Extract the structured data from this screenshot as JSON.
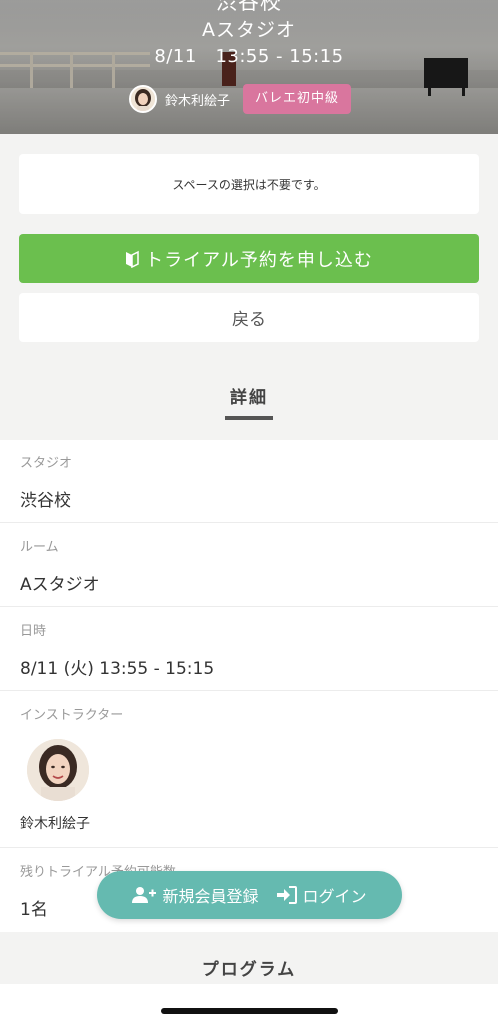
{
  "hero": {
    "school": "渋谷校",
    "room": "Aスタジオ",
    "datetime": "8/11   13:55 - 15:15",
    "instructor": "鈴木利絵子",
    "tag": "バレエ初中級"
  },
  "notice": "スペースの選択は不要です。",
  "actions": {
    "trial_label": "トライアル予約を申し込む",
    "back_label": "戻る"
  },
  "details_section": {
    "title": "詳細",
    "rows": [
      {
        "label": "スタジオ",
        "value": "渋谷校"
      },
      {
        "label": "ルーム",
        "value": "Aスタジオ"
      },
      {
        "label": "日時",
        "value": "8/11 (火) 13:55 - 15:15"
      },
      {
        "label": "インストラクター",
        "value": "鈴木利絵子"
      },
      {
        "label": "残りトライアル予約可能数",
        "value": "1名"
      }
    ]
  },
  "program_section": {
    "title": "プログラム"
  },
  "floating_bar": {
    "register_label": "新規会員登録",
    "login_label": "ログイン"
  },
  "colors": {
    "accent_green": "#6bbf4e",
    "tag_pink": "#d9769e",
    "pill_teal": "#65bab0"
  }
}
